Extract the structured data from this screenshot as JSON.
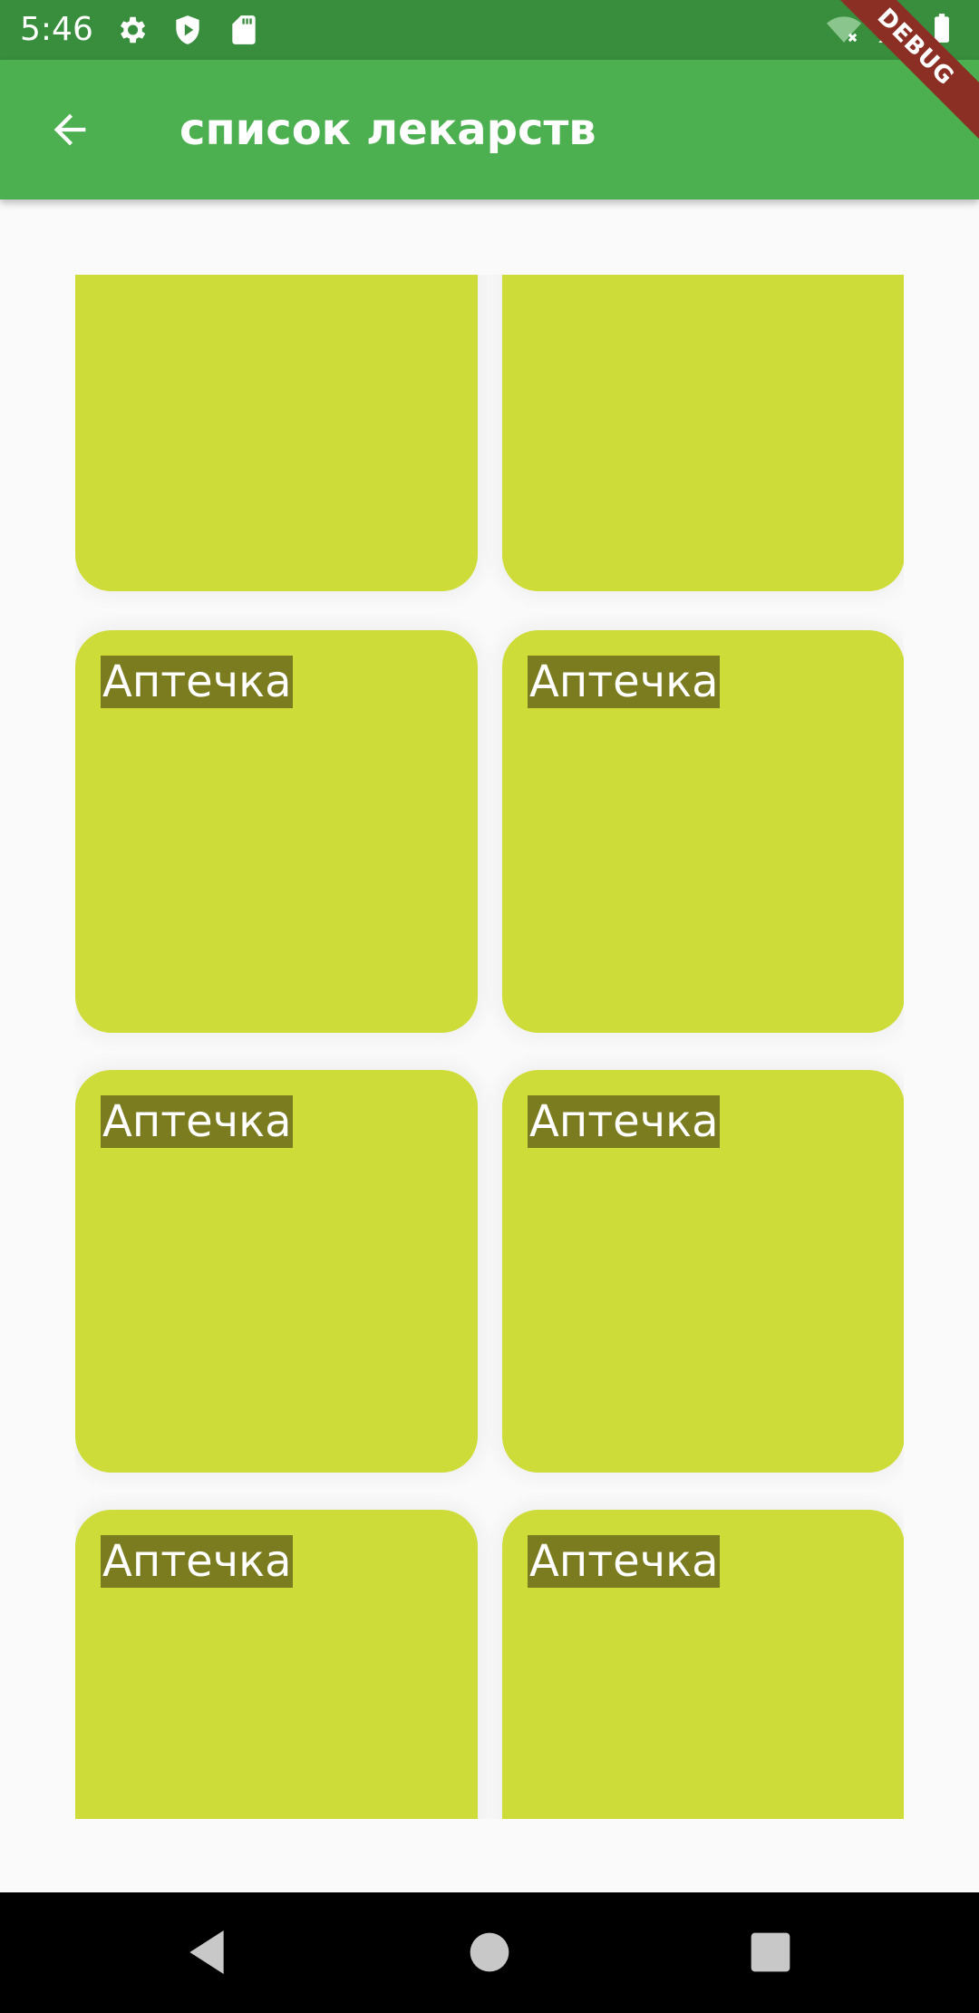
{
  "status_bar": {
    "time": "5:46",
    "left_icons": [
      "gear-icon",
      "shield-play-icon",
      "sd-card-icon"
    ],
    "right_icons": [
      "wifi-off-icon",
      "cell-signal-icon",
      "battery-icon"
    ]
  },
  "debug_banner": {
    "label": "DEBUG"
  },
  "app_bar": {
    "title": "список лекарств",
    "back_icon": "arrow-back-icon",
    "color": "#4caf50",
    "status_color": "#388e3c"
  },
  "grid": {
    "tile_color": "#cddc39",
    "label_bg": "#7a7c1f",
    "items": [
      {
        "label": ""
      },
      {
        "label": ""
      },
      {
        "label": "Аптечка"
      },
      {
        "label": "Аптечка"
      },
      {
        "label": "Аптечка"
      },
      {
        "label": "Аптечка"
      },
      {
        "label": "Аптечка"
      },
      {
        "label": "Аптечка"
      }
    ]
  },
  "nav_bar": {
    "buttons": [
      "back-triangle-icon",
      "home-circle-icon",
      "recents-square-icon"
    ]
  }
}
